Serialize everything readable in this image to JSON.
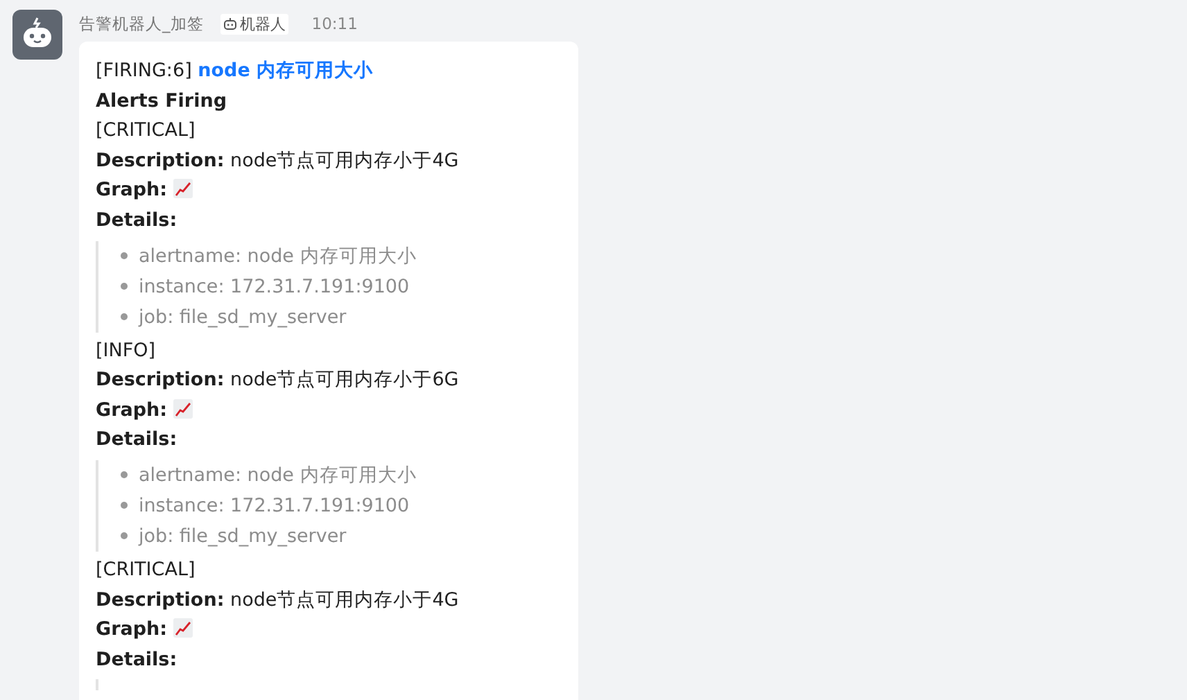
{
  "sender": {
    "name": "告警机器人_加签",
    "badge": "机器人",
    "time": "10:11"
  },
  "message": {
    "prefix": "[FIRING:6]",
    "title": "node 内存可用大小",
    "heading": "Alerts Firing",
    "alerts": [
      {
        "severity": "[CRITICAL]",
        "description_label": "Description:",
        "description": "node节点可用内存小于4G",
        "graph_label": "Graph:",
        "details_label": "Details:",
        "details": [
          "alertname: node 内存可用大小",
          "instance: 172.31.7.191:9100",
          "job: file_sd_my_server"
        ]
      },
      {
        "severity": "[INFO]",
        "description_label": "Description:",
        "description": "node节点可用内存小于6G",
        "graph_label": "Graph:",
        "details_label": "Details:",
        "details": [
          "alertname: node 内存可用大小",
          "instance: 172.31.7.191:9100",
          "job: file_sd_my_server"
        ]
      },
      {
        "severity": "[CRITICAL]",
        "description_label": "Description:",
        "description": "node节点可用内存小于4G",
        "graph_label": "Graph:",
        "details_label": "Details:"
      }
    ]
  }
}
